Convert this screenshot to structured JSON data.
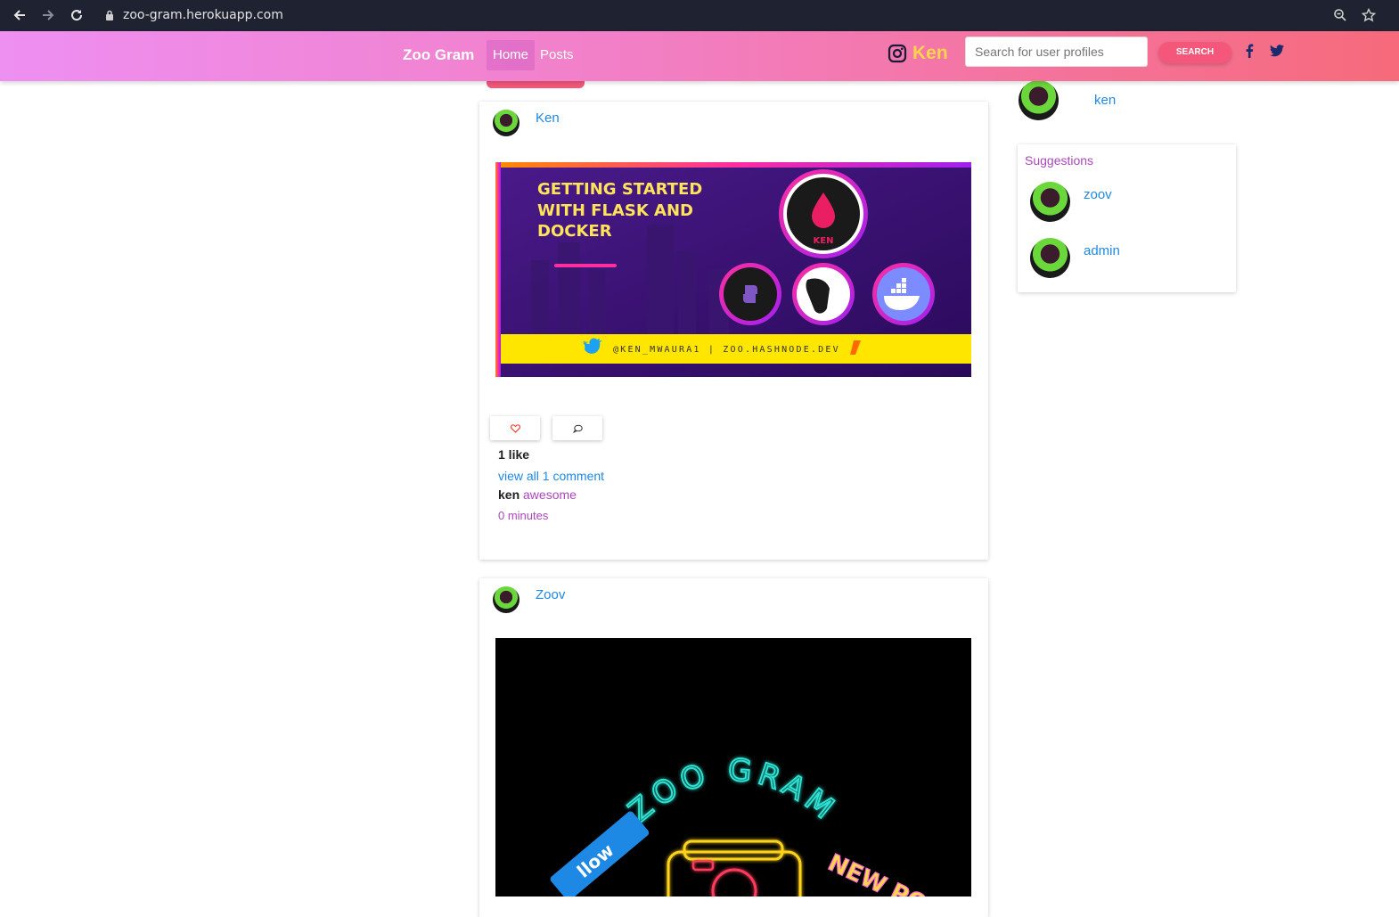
{
  "browser": {
    "url": "zoo-gram.herokuapp.com"
  },
  "navbar": {
    "brand": "Zoo Gram",
    "links": [
      "Home",
      "Posts"
    ],
    "active": "Home",
    "user": "Ken",
    "search_placeholder": "Search for user profiles",
    "search_button": "SEARCH",
    "colors": {
      "gradient_start": "#ee8ff2",
      "gradient_end": "#f66a7b",
      "user_color": "#ffd54a"
    }
  },
  "posts": [
    {
      "author": "Ken",
      "image": {
        "headline_lines": [
          "GETTING STARTED",
          "WITH FLASK AND",
          "DOCKER"
        ],
        "logo_text": "KEN",
        "footer": "@KEN_MWAURA1  |  ZOO.HASHNODE.DEV"
      },
      "likes": "1 like",
      "view_comments": "view all 1 comment",
      "comment": {
        "user": "ken",
        "text": "awesome"
      },
      "time": "0 minutes"
    },
    {
      "author": "Zoov",
      "image": {
        "neon_title": "ZOO GRAM",
        "ribbon_left": "llow",
        "ribbon_right": "NEW PO"
      }
    }
  ],
  "sidebar": {
    "current_user": "ken",
    "suggestions_title": "Suggestions",
    "suggestions": [
      "zoov",
      "admin"
    ]
  }
}
